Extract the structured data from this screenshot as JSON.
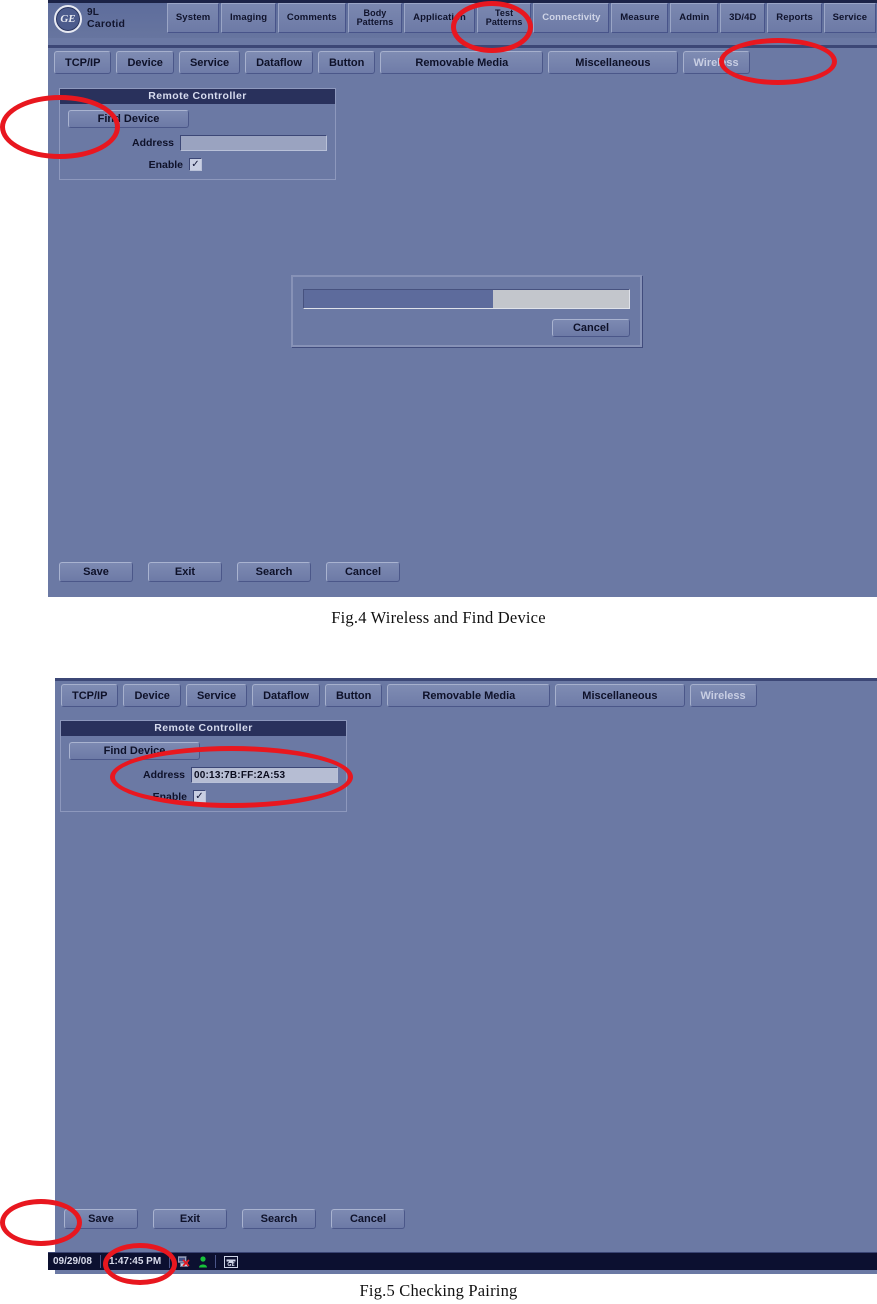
{
  "document": {
    "captions": [
      {
        "id": "fig4",
        "text": "Fig.4 Wireless and Find Device"
      },
      {
        "id": "fig5",
        "text": "Fig.5 Checking Pairing"
      }
    ]
  },
  "colors": {
    "screen_background": "#6b79a4",
    "panel_header": "#29315c",
    "button_face": "#7b88b0",
    "annotation_red": "#e8171f",
    "statusbar": "#0c1030",
    "progress_fill": "#5d6b9c",
    "progress_track": "#c3c6cc"
  },
  "figure4": {
    "topbar": {
      "probe": {
        "logo": "ge-logo",
        "line1": "9L",
        "line2": "Carotid"
      },
      "menu_items": [
        {
          "label": "System",
          "two_line": false,
          "selected": false
        },
        {
          "label": "Imaging",
          "two_line": false,
          "selected": false
        },
        {
          "label": "Comments",
          "two_line": false,
          "selected": false
        },
        {
          "label": "Body\nPatterns",
          "two_line": true,
          "selected": false
        },
        {
          "label": "Application",
          "two_line": false,
          "selected": false
        },
        {
          "label": "Test\nPatterns",
          "two_line": true,
          "selected": false
        },
        {
          "label": "Connectivity",
          "two_line": false,
          "selected": true
        },
        {
          "label": "Measure",
          "two_line": false,
          "selected": false
        },
        {
          "label": "Admin",
          "two_line": false,
          "selected": false
        },
        {
          "label": "3D/4D",
          "two_line": false,
          "selected": false
        },
        {
          "label": "Reports",
          "two_line": false,
          "selected": false
        },
        {
          "label": "Service",
          "two_line": false,
          "selected": false
        }
      ]
    },
    "tabs": [
      {
        "label": "TCP/IP",
        "selected": false,
        "width": "normal"
      },
      {
        "label": "Device",
        "selected": false,
        "width": "normal"
      },
      {
        "label": "Service",
        "selected": false,
        "width": "normal"
      },
      {
        "label": "Dataflow",
        "selected": false,
        "width": "normal"
      },
      {
        "label": "Button",
        "selected": false,
        "width": "normal"
      },
      {
        "label": "Removable Media",
        "selected": false,
        "width": "wide"
      },
      {
        "label": "Miscellaneous",
        "selected": false,
        "width": "wide2"
      },
      {
        "label": "Wireless",
        "selected": true,
        "width": "normal"
      }
    ],
    "remote_controller": {
      "title": "Remote Controller",
      "find_device_label": "Find Device",
      "address_label": "Address",
      "address_value": "",
      "enable_label": "Enable",
      "enable_checked": true,
      "enable_mark": "✓"
    },
    "progress_dialog": {
      "progress_percent": 58,
      "cancel_label": "Cancel"
    },
    "action_buttons": [
      {
        "label": "Save"
      },
      {
        "label": "Exit"
      },
      {
        "label": "Search"
      },
      {
        "label": "Cancel"
      }
    ],
    "annotations": [
      {
        "name": "annotation-test-patterns",
        "target": "Test Patterns menu button"
      },
      {
        "name": "annotation-wireless-tab",
        "target": "Wireless tab"
      },
      {
        "name": "annotation-find-device",
        "target": "Find Device button"
      }
    ]
  },
  "figure5": {
    "tabs": [
      {
        "label": "TCP/IP",
        "selected": false,
        "width": "normal"
      },
      {
        "label": "Device",
        "selected": false,
        "width": "normal"
      },
      {
        "label": "Service",
        "selected": false,
        "width": "normal"
      },
      {
        "label": "Dataflow",
        "selected": false,
        "width": "normal"
      },
      {
        "label": "Button",
        "selected": false,
        "width": "normal"
      },
      {
        "label": "Removable Media",
        "selected": false,
        "width": "wide"
      },
      {
        "label": "Miscellaneous",
        "selected": false,
        "width": "wide2"
      },
      {
        "label": "Wireless",
        "selected": true,
        "width": "normal"
      }
    ],
    "remote_controller": {
      "title": "Remote Controller",
      "find_device_label": "Find Device",
      "address_label": "Address",
      "address_value": "00:13:7B:FF:2A:53",
      "enable_label": "Enable",
      "enable_checked": true,
      "enable_mark": "✓"
    },
    "action_buttons": [
      {
        "label": "Save"
      },
      {
        "label": "Exit"
      },
      {
        "label": "Search"
      },
      {
        "label": "Cancel"
      }
    ],
    "statusbar": {
      "date": "09/29/08",
      "time": "1:47:45 PM",
      "icons": [
        {
          "name": "network-disconnected-icon"
        },
        {
          "name": "operator-icon"
        },
        {
          "name": "ge-phone-icon"
        }
      ]
    },
    "annotations": [
      {
        "name": "annotation-address-field",
        "target": "Address value field"
      },
      {
        "name": "annotation-save-button",
        "target": "Save button"
      },
      {
        "name": "annotation-clock",
        "target": "Status bar clock"
      }
    ]
  }
}
